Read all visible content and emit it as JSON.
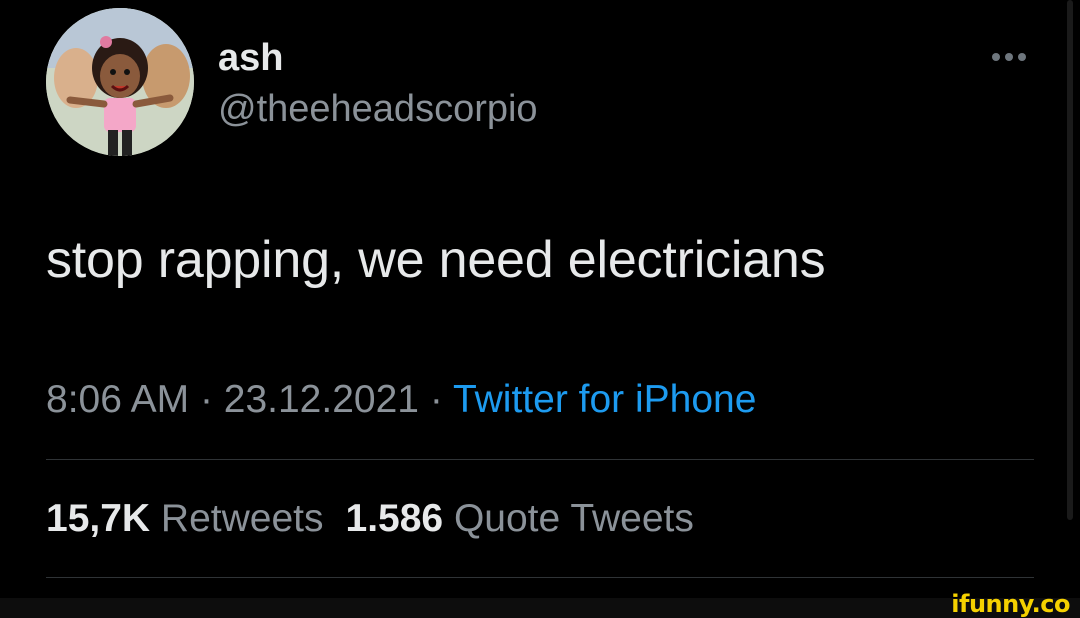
{
  "user": {
    "display_name": "ash",
    "handle": "@theeheadscorpio",
    "avatar_icon": "cartoon-avatar-icon"
  },
  "tweet": {
    "text": "stop rapping, we need electricians",
    "time": "8:06 AM",
    "separator": "·",
    "date": "23.12.2021",
    "source": "Twitter for iPhone"
  },
  "stats": {
    "retweets_count": "15,7K",
    "retweets_label": "Retweets",
    "quotes_count": "1.586",
    "quotes_label": "Quote Tweets"
  },
  "more_icon": "ellipsis-icon",
  "watermark": "ifunny.co",
  "colors": {
    "background": "#000000",
    "primary_text": "#e7e9ea",
    "secondary_text": "#8b9299",
    "link": "#1d9bf0",
    "divider": "#2f3336",
    "watermark": "#f5d100"
  }
}
